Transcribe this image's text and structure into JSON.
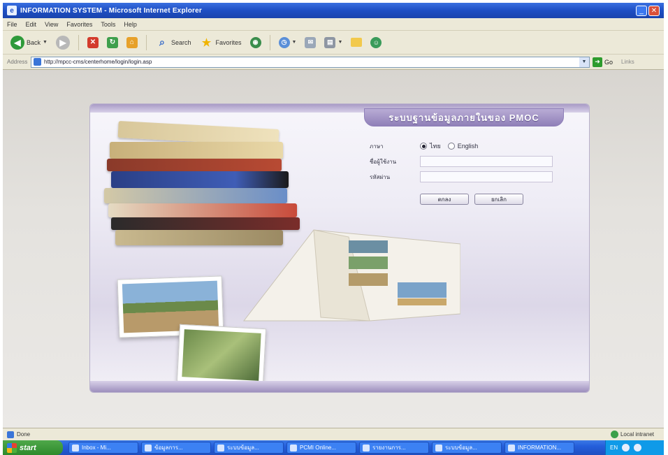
{
  "window": {
    "title": "INFORMATION SYSTEM - Microsoft Internet Explorer",
    "minimize": "_",
    "close": "✕"
  },
  "menu": [
    "File",
    "Edit",
    "View",
    "Favorites",
    "Tools",
    "Help"
  ],
  "toolbar": {
    "back_label": "Back",
    "search_label": "Search",
    "favorites_label": "Favorites"
  },
  "address": {
    "label": "Address",
    "url": "http://mpcc-cms/centerhome/login/login.asp",
    "go_label": "Go",
    "links_label": "Links"
  },
  "login_panel": {
    "header": "ระบบฐานข้อมูลภายในของ PMOC",
    "language_label": "ภาษา",
    "language_options": [
      "ไทย",
      "English"
    ],
    "language_selected": "ไทย",
    "username_label": "ชื่อผู้ใช้งาน",
    "username_value": "",
    "password_label": "รหัสผ่าน",
    "password_value": "",
    "login_button": "ตกลง",
    "cancel_button": "ยกเลิก"
  },
  "statusbar": {
    "text": "Done",
    "zone": "Local intranet"
  },
  "taskbar": {
    "start_label": "start",
    "tasks": [
      "Inbox - Mi...",
      "ข้อมูลการ...",
      "ระบบข้อมูล...",
      "PCMI Online...",
      "รายงานการ...",
      "ระบบข้อมูล...",
      "INFORMATION..."
    ],
    "tray_time": "EN"
  },
  "colors": {
    "titlebar": "#1e4fc4",
    "panel_accent": "#8f7fb8",
    "taskbar": "#245edb",
    "start_button": "#2e8a2b"
  }
}
